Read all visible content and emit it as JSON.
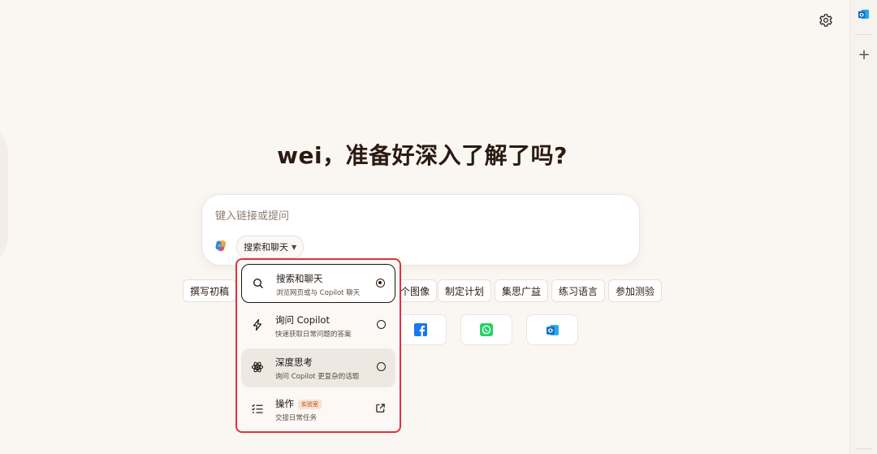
{
  "greeting": "wei，准备好深入了解了吗?",
  "composer": {
    "placeholder": "键入链接或提问",
    "mode_label": "搜索和聊天"
  },
  "chips": [
    "撰写初稿",
    "个图像",
    "制定计划",
    "集思广益",
    "练习语言",
    "参加测验"
  ],
  "share_targets": [
    {
      "icon": "facebook-icon",
      "color": "#1877f2"
    },
    {
      "icon": "whatsapp-icon",
      "color": "#25d366"
    },
    {
      "icon": "outlook-icon",
      "color": "#0f6cbd"
    }
  ],
  "dropdown": {
    "options": [
      {
        "title": "搜索和聊天",
        "desc": "浏览网页或与 Copilot 聊天",
        "selected": true,
        "icon": "search-icon"
      },
      {
        "title": "询问 Copilot",
        "desc": "快速获取日常问题的答案",
        "selected": false,
        "icon": "lightning-icon"
      },
      {
        "title": "深度思考",
        "desc": "询问 Copilot 更复杂的话题",
        "selected": false,
        "icon": "atom-icon"
      },
      {
        "title": "操作",
        "badge": "实验室",
        "desc": "交接日常任务",
        "icon": "checklist-icon",
        "external": true
      }
    ]
  },
  "side_panel": {
    "add_label": "+"
  },
  "colors": {
    "background": "#faf7f3",
    "highlight_border": "#e0323a",
    "text": "#2b1a10"
  }
}
